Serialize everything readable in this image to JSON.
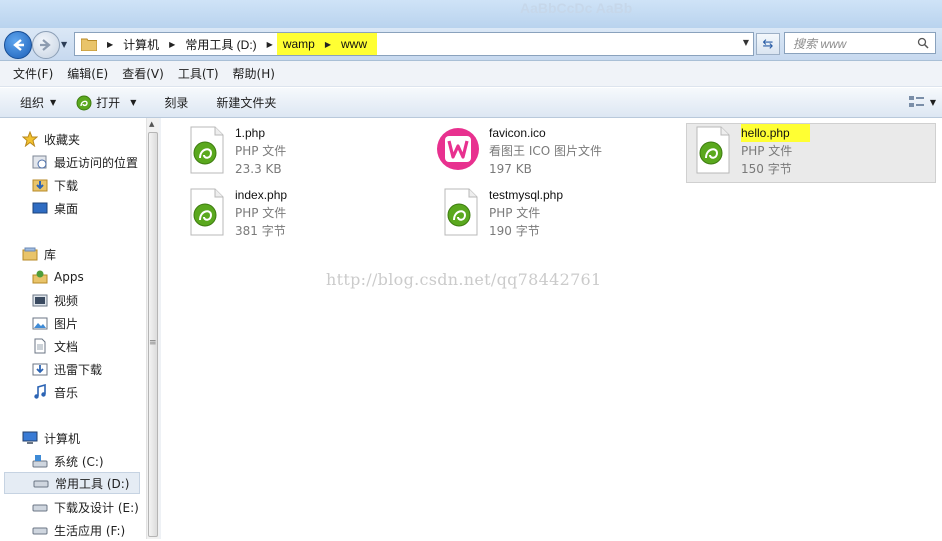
{
  "header_brand": "AaBbCcDc AaBb",
  "nav": {
    "breadcrumbs": [
      "计算机",
      "常用工具 (D:)",
      "wamp",
      "www"
    ],
    "search_placeholder": "搜索 www"
  },
  "menu": [
    "文件(F)",
    "编辑(E)",
    "查看(V)",
    "工具(T)",
    "帮助(H)"
  ],
  "toolbar": {
    "organize": "组织",
    "open": "打开",
    "burn": "刻录",
    "new_folder": "新建文件夹"
  },
  "sidebar": {
    "favorites": {
      "label": "收藏夹",
      "items": [
        "最近访问的位置",
        "下载",
        "桌面"
      ]
    },
    "libraries": {
      "label": "库",
      "items": [
        "Apps",
        "视频",
        "图片",
        "文档",
        "迅雷下载",
        "音乐"
      ]
    },
    "computer": {
      "label": "计算机",
      "items": [
        "系统 (C:)",
        "常用工具 (D:)",
        "下载及设计 (E:)",
        "生活应用 (F:)"
      ]
    }
  },
  "files": [
    {
      "name": "1.php",
      "type": "PHP 文件",
      "size": "23.3 KB",
      "icon": "php-file-icon"
    },
    {
      "name": "favicon.ico",
      "type": "看图王 ICO 图片文件",
      "size": "197 KB",
      "icon": "wamp-logo-icon"
    },
    {
      "name": "hello.php",
      "type": "PHP 文件",
      "size": "150 字节",
      "icon": "php-file-icon"
    },
    {
      "name": "index.php",
      "type": "PHP 文件",
      "size": "381 字节",
      "icon": "php-file-icon"
    },
    {
      "name": "testmysql.php",
      "type": "PHP 文件",
      "size": "190 字节",
      "icon": "php-file-icon"
    }
  ],
  "watermark": "http://blog.csdn.net/qq78442761",
  "colors": {
    "highlight": "#ffff33",
    "selection": "#eaeaea",
    "php_green": "#5aa81e",
    "wamp_pink": "#e8318f"
  }
}
